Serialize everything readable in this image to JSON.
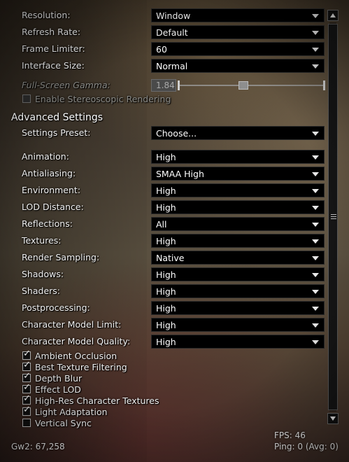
{
  "general": {
    "resolution": {
      "label": "Resolution:",
      "value": "Window"
    },
    "refresh_rate": {
      "label": "Refresh Rate:",
      "value": "Default"
    },
    "frame_limiter": {
      "label": "Frame Limiter:",
      "value": "60"
    },
    "interface_size": {
      "label": "Interface Size:",
      "value": "Normal"
    },
    "gamma": {
      "label": "Full-Screen Gamma:",
      "value": "1.84",
      "slider_fraction": 0.44
    },
    "stereoscopic": {
      "label": "Enable Stereoscopic Rendering",
      "checked": false
    }
  },
  "advanced": {
    "title": "Advanced Settings",
    "preset": {
      "label": "Settings Preset:",
      "value": "Choose..."
    },
    "animation": {
      "label": "Animation:",
      "value": "High"
    },
    "antialiasing": {
      "label": "Antialiasing:",
      "value": "SMAA High"
    },
    "environment": {
      "label": "Environment:",
      "value": "High"
    },
    "lod_distance": {
      "label": "LOD Distance:",
      "value": "High"
    },
    "reflections": {
      "label": "Reflections:",
      "value": "All"
    },
    "textures": {
      "label": "Textures:",
      "value": "High"
    },
    "render_sampling": {
      "label": "Render Sampling:",
      "value": "Native"
    },
    "shadows": {
      "label": "Shadows:",
      "value": "High"
    },
    "shaders": {
      "label": "Shaders:",
      "value": "High"
    },
    "postprocessing": {
      "label": "Postprocessing:",
      "value": "High"
    },
    "char_model_limit": {
      "label": "Character Model Limit:",
      "value": "High"
    },
    "char_model_quality": {
      "label": "Character Model Quality:",
      "value": "High"
    },
    "checkboxes": [
      {
        "label": "Ambient Occlusion",
        "checked": true
      },
      {
        "label": "Best Texture Filtering",
        "checked": true
      },
      {
        "label": "Depth Blur",
        "checked": true
      },
      {
        "label": "Effect LOD",
        "checked": true
      },
      {
        "label": "High-Res Character Textures",
        "checked": true
      },
      {
        "label": "Light Adaptation",
        "checked": true
      },
      {
        "label": "Vertical Sync",
        "checked": false
      }
    ]
  },
  "footer": {
    "gw2": "Gw2: 67,258",
    "fps": "FPS: 46",
    "ping": "Ping: 0 (Avg: 0)"
  },
  "icons": {
    "check": "✓",
    "grip": "≡"
  }
}
